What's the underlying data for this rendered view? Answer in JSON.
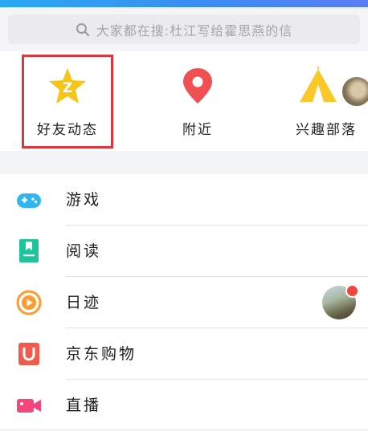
{
  "search": {
    "placeholder": "大家都在搜:杜江写给霍思燕的信"
  },
  "quick_items": [
    {
      "label": "好友动态",
      "icon": "qzone-star-icon",
      "color": "#f5c518"
    },
    {
      "label": "附近",
      "icon": "location-pin-icon",
      "color": "#f04f53"
    },
    {
      "label": "兴趣部落",
      "icon": "tent-icon",
      "color": "#f9c829"
    }
  ],
  "menu": [
    {
      "label": "游戏",
      "icon": "gamepad-icon",
      "color": "#2eb6f2"
    },
    {
      "label": "阅读",
      "icon": "book-icon",
      "color": "#1fc49c"
    },
    {
      "label": "日迹",
      "icon": "play-circle-icon",
      "color": "#ff9b2e"
    },
    {
      "label": "京东购物",
      "icon": "jd-bag-icon",
      "color": "#f25a4e"
    },
    {
      "label": "直播",
      "icon": "video-camera-icon",
      "color": "#f5457b"
    }
  ],
  "accent": "#e0353b"
}
